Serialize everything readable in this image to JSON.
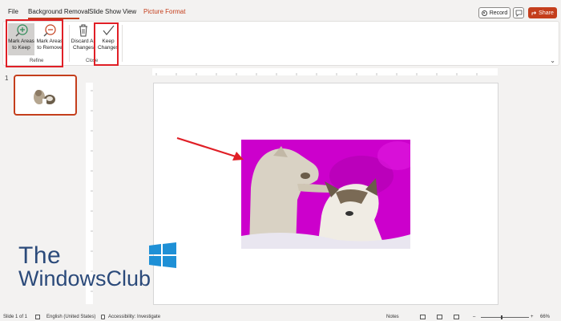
{
  "tabs": {
    "file": "File",
    "background_removal": "Background Removal",
    "slide_show": "Slide Show",
    "view": "View",
    "picture_format": "Picture Format"
  },
  "header_buttons": {
    "record": "Record",
    "share": "Share"
  },
  "ribbon": {
    "mark_keep_line1": "Mark Areas",
    "mark_keep_line2": "to Keep",
    "mark_remove_line1": "Mark Areas",
    "mark_remove_line2": "to Remove",
    "refine_label": "Refine",
    "discard_line1": "Discard All",
    "discard_line2": "Changes",
    "keep_line1": "Keep",
    "keep_line2": "Changes",
    "close_label": "Close"
  },
  "thumbnails": {
    "slide_number": "1"
  },
  "watermark": {
    "line1": "The",
    "line2": "WindowsClub"
  },
  "status_bar": {
    "slide": "Slide 1 of 1",
    "language": "English (United States)",
    "accessibility": "Accessibility: Investigate",
    "notes": "Notes",
    "zoom": "66%"
  },
  "colors": {
    "accent": "#c43e1c",
    "highlight_box": "#e01f26",
    "removed_background": "#cc00cc"
  }
}
